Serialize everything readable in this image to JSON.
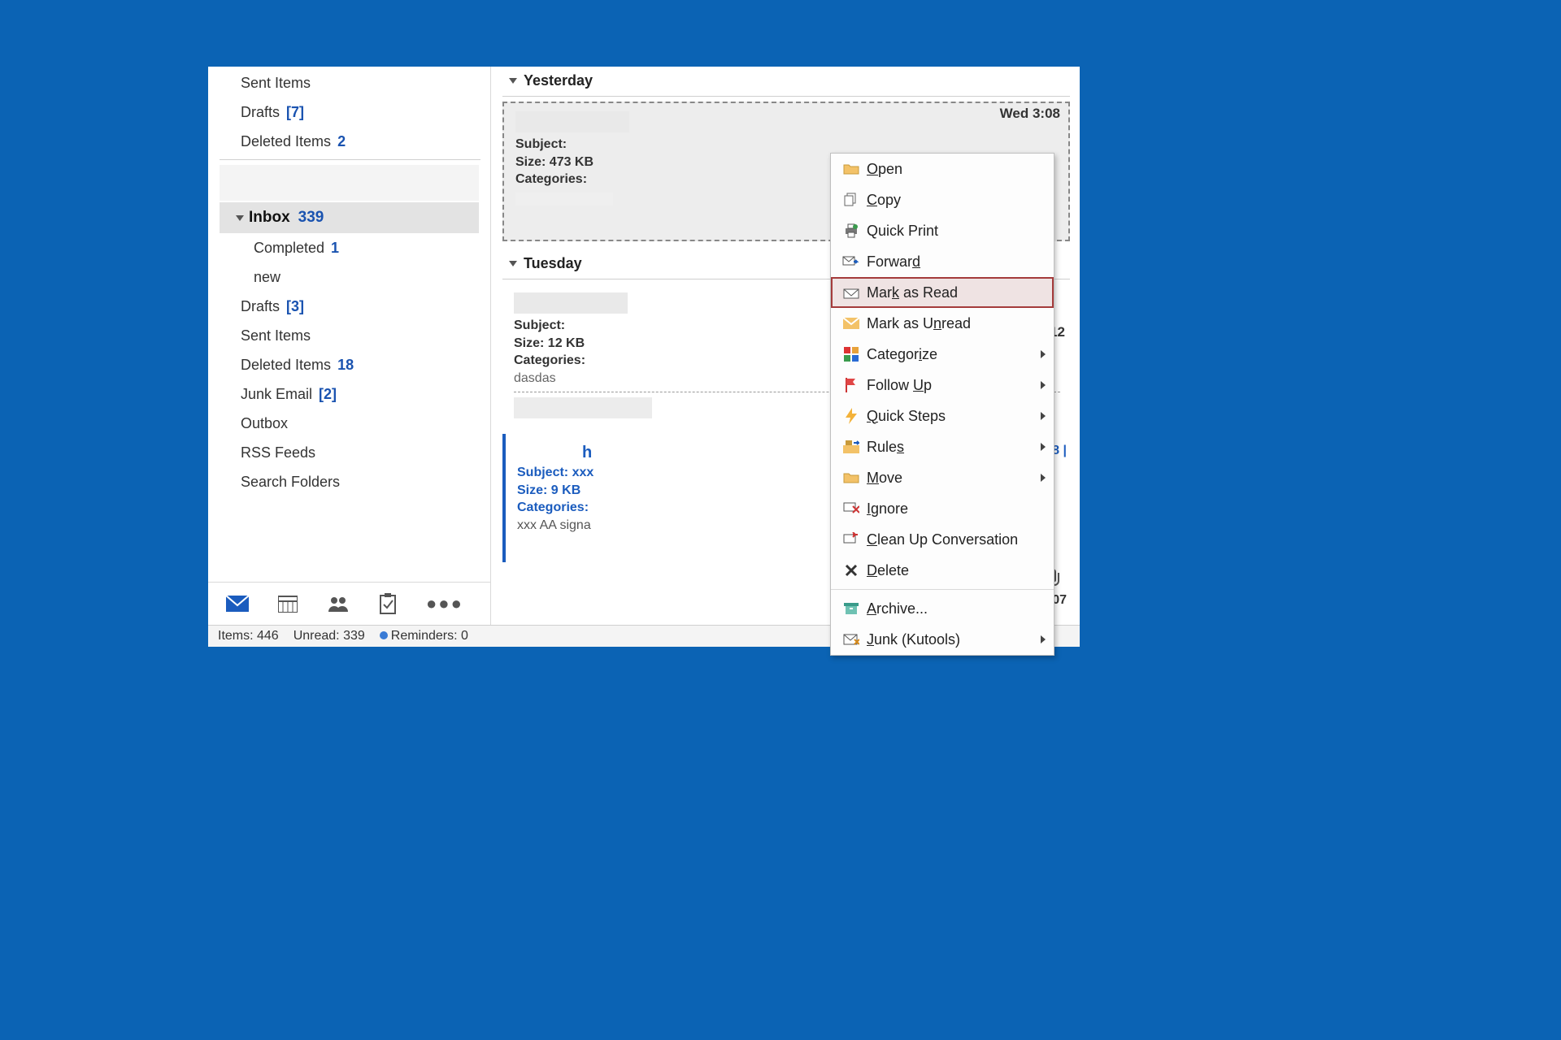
{
  "sidebar": {
    "top_folders": [
      {
        "label": "Sent Items",
        "count": ""
      },
      {
        "label": "Drafts",
        "count": "[7]"
      },
      {
        "label": "Deleted Items",
        "count": "2"
      }
    ],
    "inbox": {
      "label": "Inbox",
      "count": "339"
    },
    "sub_folders": [
      {
        "label": "Completed",
        "count": "1"
      },
      {
        "label": "new",
        "count": ""
      }
    ],
    "folders": [
      {
        "label": "Drafts",
        "count": "[3]"
      },
      {
        "label": "Sent Items",
        "count": ""
      },
      {
        "label": "Deleted Items",
        "count": "18"
      },
      {
        "label": "Junk Email",
        "count": "[2]"
      },
      {
        "label": "Outbox",
        "count": ""
      },
      {
        "label": "RSS Feeds",
        "count": ""
      },
      {
        "label": "Search Folders",
        "count": ""
      }
    ]
  },
  "groups": {
    "yesterday": "Yesterday",
    "tuesday": "Tuesday"
  },
  "messages": {
    "m1": {
      "subject_label": "Subject:",
      "subject_tail": "",
      "size_label": "Size: 473 KB",
      "cat_label": "Categories:",
      "time": "Wed 3:08"
    },
    "m2": {
      "subject_label": "Subject:",
      "size_label": "Size: 12 KB",
      "cat_label": "Categories:",
      "preview": "dasdas",
      "time_tail": ":12"
    },
    "m3": {
      "from_tail": "h",
      "subject_label": "Subject: xxx",
      "size_label": "Size: 9 KB",
      "cat_label": "Categories:",
      "preview": "xxx  AA signa",
      "time_tail": "08 |",
      "time_tail2": ":07"
    }
  },
  "context_menu": {
    "open": "Open",
    "copy": "Copy",
    "quick_print": "Quick Print",
    "forward": "Forward",
    "mark_read": "Mark as Read",
    "mark_unread": "Mark as Unread",
    "categorize": "Categorize",
    "follow_up": "Follow Up",
    "quick_steps": "Quick Steps",
    "rules": "Rules",
    "move": "Move",
    "ignore": "Ignore",
    "clean_up": "Clean Up Conversation",
    "delete": "Delete",
    "archive": "Archive...",
    "junk": "Junk (Kutools)"
  },
  "status": {
    "items": "Items: 446",
    "unread": "Unread: 339",
    "reminders": "Reminders: 0"
  }
}
